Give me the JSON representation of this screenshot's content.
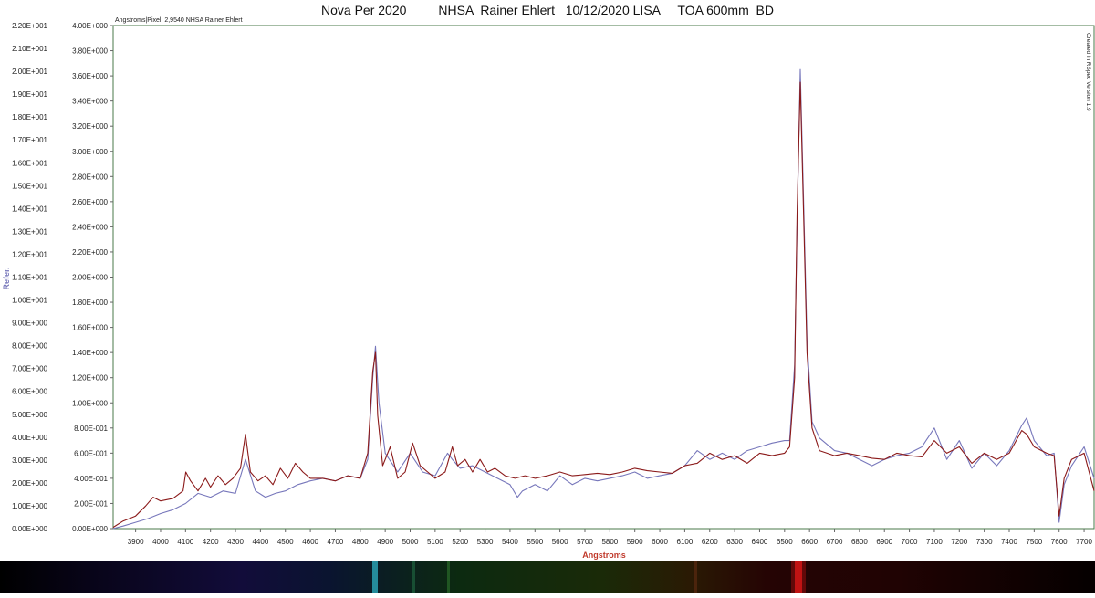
{
  "title": "Nova Per 2020         NHSA  Rainer Ehlert   10/12/2020 LISA     TOA 600mm  BD",
  "chart_data": {
    "type": "line",
    "subtitle": "Angstroms|Pixel: 2,9540 NHSA Rainer Ehlert",
    "side_note": "Created in RSpec Version 1.9",
    "xlabel": "Angstroms",
    "ylabel": "Refer.",
    "xlim": [
      3810,
      7740
    ],
    "x_ticks": [
      3900,
      4000,
      4100,
      4200,
      4300,
      4400,
      4500,
      4600,
      4700,
      4800,
      4900,
      5000,
      5100,
      5200,
      5300,
      5400,
      5500,
      5600,
      5700,
      5800,
      5900,
      6000,
      6100,
      6200,
      6300,
      6400,
      6500,
      6600,
      6700,
      6800,
      6900,
      7000,
      7100,
      7200,
      7300,
      7400,
      7500,
      7600,
      7700
    ],
    "y_left": {
      "lim": [
        0,
        22
      ],
      "ticks": [
        "0.00E+000",
        "1.00E+000",
        "2.00E+000",
        "3.00E+000",
        "4.00E+000",
        "5.00E+000",
        "6.00E+000",
        "7.00E+000",
        "8.00E+000",
        "9.00E+000",
        "1.00E+001",
        "1.10E+001",
        "1.20E+001",
        "1.30E+001",
        "1.40E+001",
        "1.50E+001",
        "1.60E+001",
        "1.70E+001",
        "1.80E+001",
        "1.90E+001",
        "2.00E+001",
        "2.10E+001",
        "2.20E+001"
      ]
    },
    "y_right": {
      "lim": [
        0,
        4
      ],
      "ticks": [
        "0.00E+000",
        "2.00E-001",
        "4.00E-001",
        "6.00E-001",
        "8.00E-001",
        "1.00E+000",
        "1.20E+000",
        "1.40E+000",
        "1.60E+000",
        "1.80E+000",
        "2.00E+000",
        "2.20E+000",
        "2.40E+000",
        "2.60E+000",
        "2.80E+000",
        "3.00E+000",
        "3.20E+000",
        "3.40E+000",
        "3.60E+000",
        "3.80E+000",
        "4.00E+000"
      ]
    },
    "grid": false,
    "series": [
      {
        "color": "#8b1a1a",
        "x": [
          3810,
          3850,
          3900,
          3940,
          3970,
          4000,
          4050,
          4090,
          4101,
          4120,
          4150,
          4180,
          4200,
          4230,
          4260,
          4290,
          4320,
          4340,
          4360,
          4390,
          4420,
          4450,
          4480,
          4510,
          4540,
          4570,
          4600,
          4650,
          4700,
          4750,
          4800,
          4830,
          4850,
          4861,
          4870,
          4890,
          4920,
          4950,
          4980,
          5010,
          5040,
          5070,
          5100,
          5140,
          5169,
          5190,
          5220,
          5250,
          5280,
          5310,
          5340,
          5380,
          5420,
          5460,
          5500,
          5550,
          5600,
          5650,
          5700,
          5750,
          5800,
          5850,
          5900,
          5950,
          6000,
          6050,
          6100,
          6150,
          6200,
          6250,
          6300,
          6350,
          6400,
          6450,
          6500,
          6520,
          6540,
          6550,
          6563,
          6575,
          6590,
          6610,
          6640,
          6700,
          6750,
          6800,
          6850,
          6900,
          6950,
          7000,
          7050,
          7100,
          7150,
          7200,
          7250,
          7300,
          7350,
          7400,
          7450,
          7470,
          7500,
          7550,
          7580,
          7600,
          7620,
          7650,
          7700,
          7740
        ],
        "values": [
          0.01,
          0.06,
          0.1,
          0.18,
          0.25,
          0.22,
          0.24,
          0.3,
          0.45,
          0.38,
          0.3,
          0.4,
          0.33,
          0.42,
          0.35,
          0.4,
          0.48,
          0.75,
          0.45,
          0.38,
          0.42,
          0.35,
          0.48,
          0.4,
          0.52,
          0.45,
          0.4,
          0.4,
          0.38,
          0.42,
          0.4,
          0.6,
          1.25,
          1.4,
          0.9,
          0.5,
          0.65,
          0.4,
          0.45,
          0.68,
          0.5,
          0.45,
          0.4,
          0.45,
          0.65,
          0.5,
          0.55,
          0.45,
          0.55,
          0.45,
          0.48,
          0.42,
          0.4,
          0.42,
          0.4,
          0.42,
          0.45,
          0.42,
          0.43,
          0.44,
          0.43,
          0.45,
          0.48,
          0.46,
          0.45,
          0.44,
          0.5,
          0.52,
          0.6,
          0.55,
          0.58,
          0.52,
          0.6,
          0.58,
          0.6,
          0.65,
          1.2,
          2.5,
          3.55,
          2.6,
          1.4,
          0.8,
          0.62,
          0.58,
          0.6,
          0.58,
          0.56,
          0.55,
          0.6,
          0.58,
          0.57,
          0.7,
          0.6,
          0.65,
          0.52,
          0.6,
          0.55,
          0.6,
          0.78,
          0.75,
          0.65,
          0.6,
          0.58,
          0.1,
          0.4,
          0.55,
          0.6,
          0.3
        ]
      },
      {
        "color": "#7777bb",
        "x": [
          3810,
          3850,
          3900,
          3950,
          4000,
          4050,
          4100,
          4150,
          4200,
          4250,
          4300,
          4340,
          4380,
          4420,
          4460,
          4500,
          4550,
          4600,
          4650,
          4700,
          4750,
          4800,
          4830,
          4850,
          4861,
          4875,
          4900,
          4950,
          5000,
          5050,
          5100,
          5150,
          5169,
          5200,
          5250,
          5300,
          5350,
          5400,
          5430,
          5450,
          5500,
          5550,
          5600,
          5650,
          5700,
          5750,
          5800,
          5850,
          5900,
          5950,
          6000,
          6050,
          6100,
          6150,
          6200,
          6250,
          6300,
          6350,
          6400,
          6450,
          6500,
          6520,
          6540,
          6552,
          6563,
          6575,
          6590,
          6610,
          6640,
          6700,
          6750,
          6800,
          6850,
          6900,
          6950,
          7000,
          7050,
          7100,
          7150,
          7200,
          7250,
          7300,
          7350,
          7400,
          7450,
          7470,
          7500,
          7550,
          7580,
          7600,
          7620,
          7650,
          7700,
          7740
        ],
        "values": [
          0.0,
          0.02,
          0.05,
          0.08,
          0.12,
          0.15,
          0.2,
          0.28,
          0.25,
          0.3,
          0.28,
          0.55,
          0.3,
          0.25,
          0.28,
          0.3,
          0.35,
          0.38,
          0.4,
          0.38,
          0.42,
          0.4,
          0.55,
          1.2,
          1.45,
          1.0,
          0.6,
          0.45,
          0.6,
          0.45,
          0.42,
          0.6,
          0.55,
          0.48,
          0.5,
          0.45,
          0.4,
          0.35,
          0.25,
          0.3,
          0.35,
          0.3,
          0.42,
          0.35,
          0.4,
          0.38,
          0.4,
          0.42,
          0.45,
          0.4,
          0.42,
          0.44,
          0.5,
          0.62,
          0.55,
          0.6,
          0.55,
          0.62,
          0.65,
          0.68,
          0.7,
          0.7,
          1.3,
          2.6,
          3.65,
          2.7,
          1.5,
          0.85,
          0.72,
          0.62,
          0.6,
          0.55,
          0.5,
          0.55,
          0.58,
          0.6,
          0.65,
          0.8,
          0.55,
          0.7,
          0.48,
          0.6,
          0.5,
          0.62,
          0.82,
          0.88,
          0.7,
          0.58,
          0.6,
          0.05,
          0.35,
          0.5,
          0.65,
          0.4
        ]
      }
    ]
  }
}
